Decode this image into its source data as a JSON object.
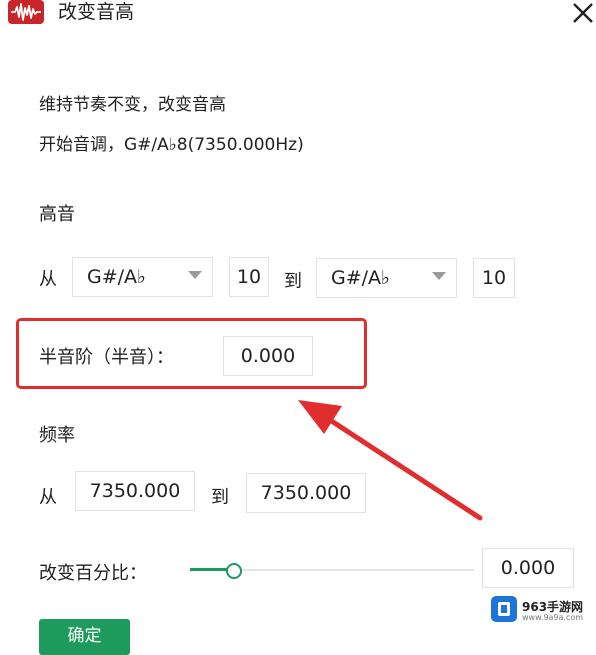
{
  "window": {
    "title": "改变音高",
    "logo_icon": "waveform-icon",
    "close_icon": "close-icon"
  },
  "description": {
    "line1": "维持节奏不变，改变音高",
    "line2": "开始音调，G#/A♭8(7350.000Hz)"
  },
  "pitch": {
    "section_label": "高音",
    "from_label": "从",
    "to_label": "到",
    "from_note": "G#/A♭",
    "from_octave": "10",
    "to_note": "G#/A♭",
    "to_octave": "10"
  },
  "semitone": {
    "label": "半音阶（半音）：",
    "value": "0.000"
  },
  "frequency": {
    "section_label": "频率",
    "from_label": "从",
    "to_label": "到",
    "from_value": "7350.000",
    "to_value": "7350.000"
  },
  "percent": {
    "label": "改变百分比：",
    "value": "0.000",
    "slider_fraction": 0.15
  },
  "buttons": {
    "ok_label": "确定"
  },
  "watermark": {
    "text": "963手游网",
    "url": "www.9a9a.com"
  },
  "colors": {
    "accent": "#1f9a5d",
    "highlight": "#e02d2d",
    "logo": "#c8262b"
  }
}
